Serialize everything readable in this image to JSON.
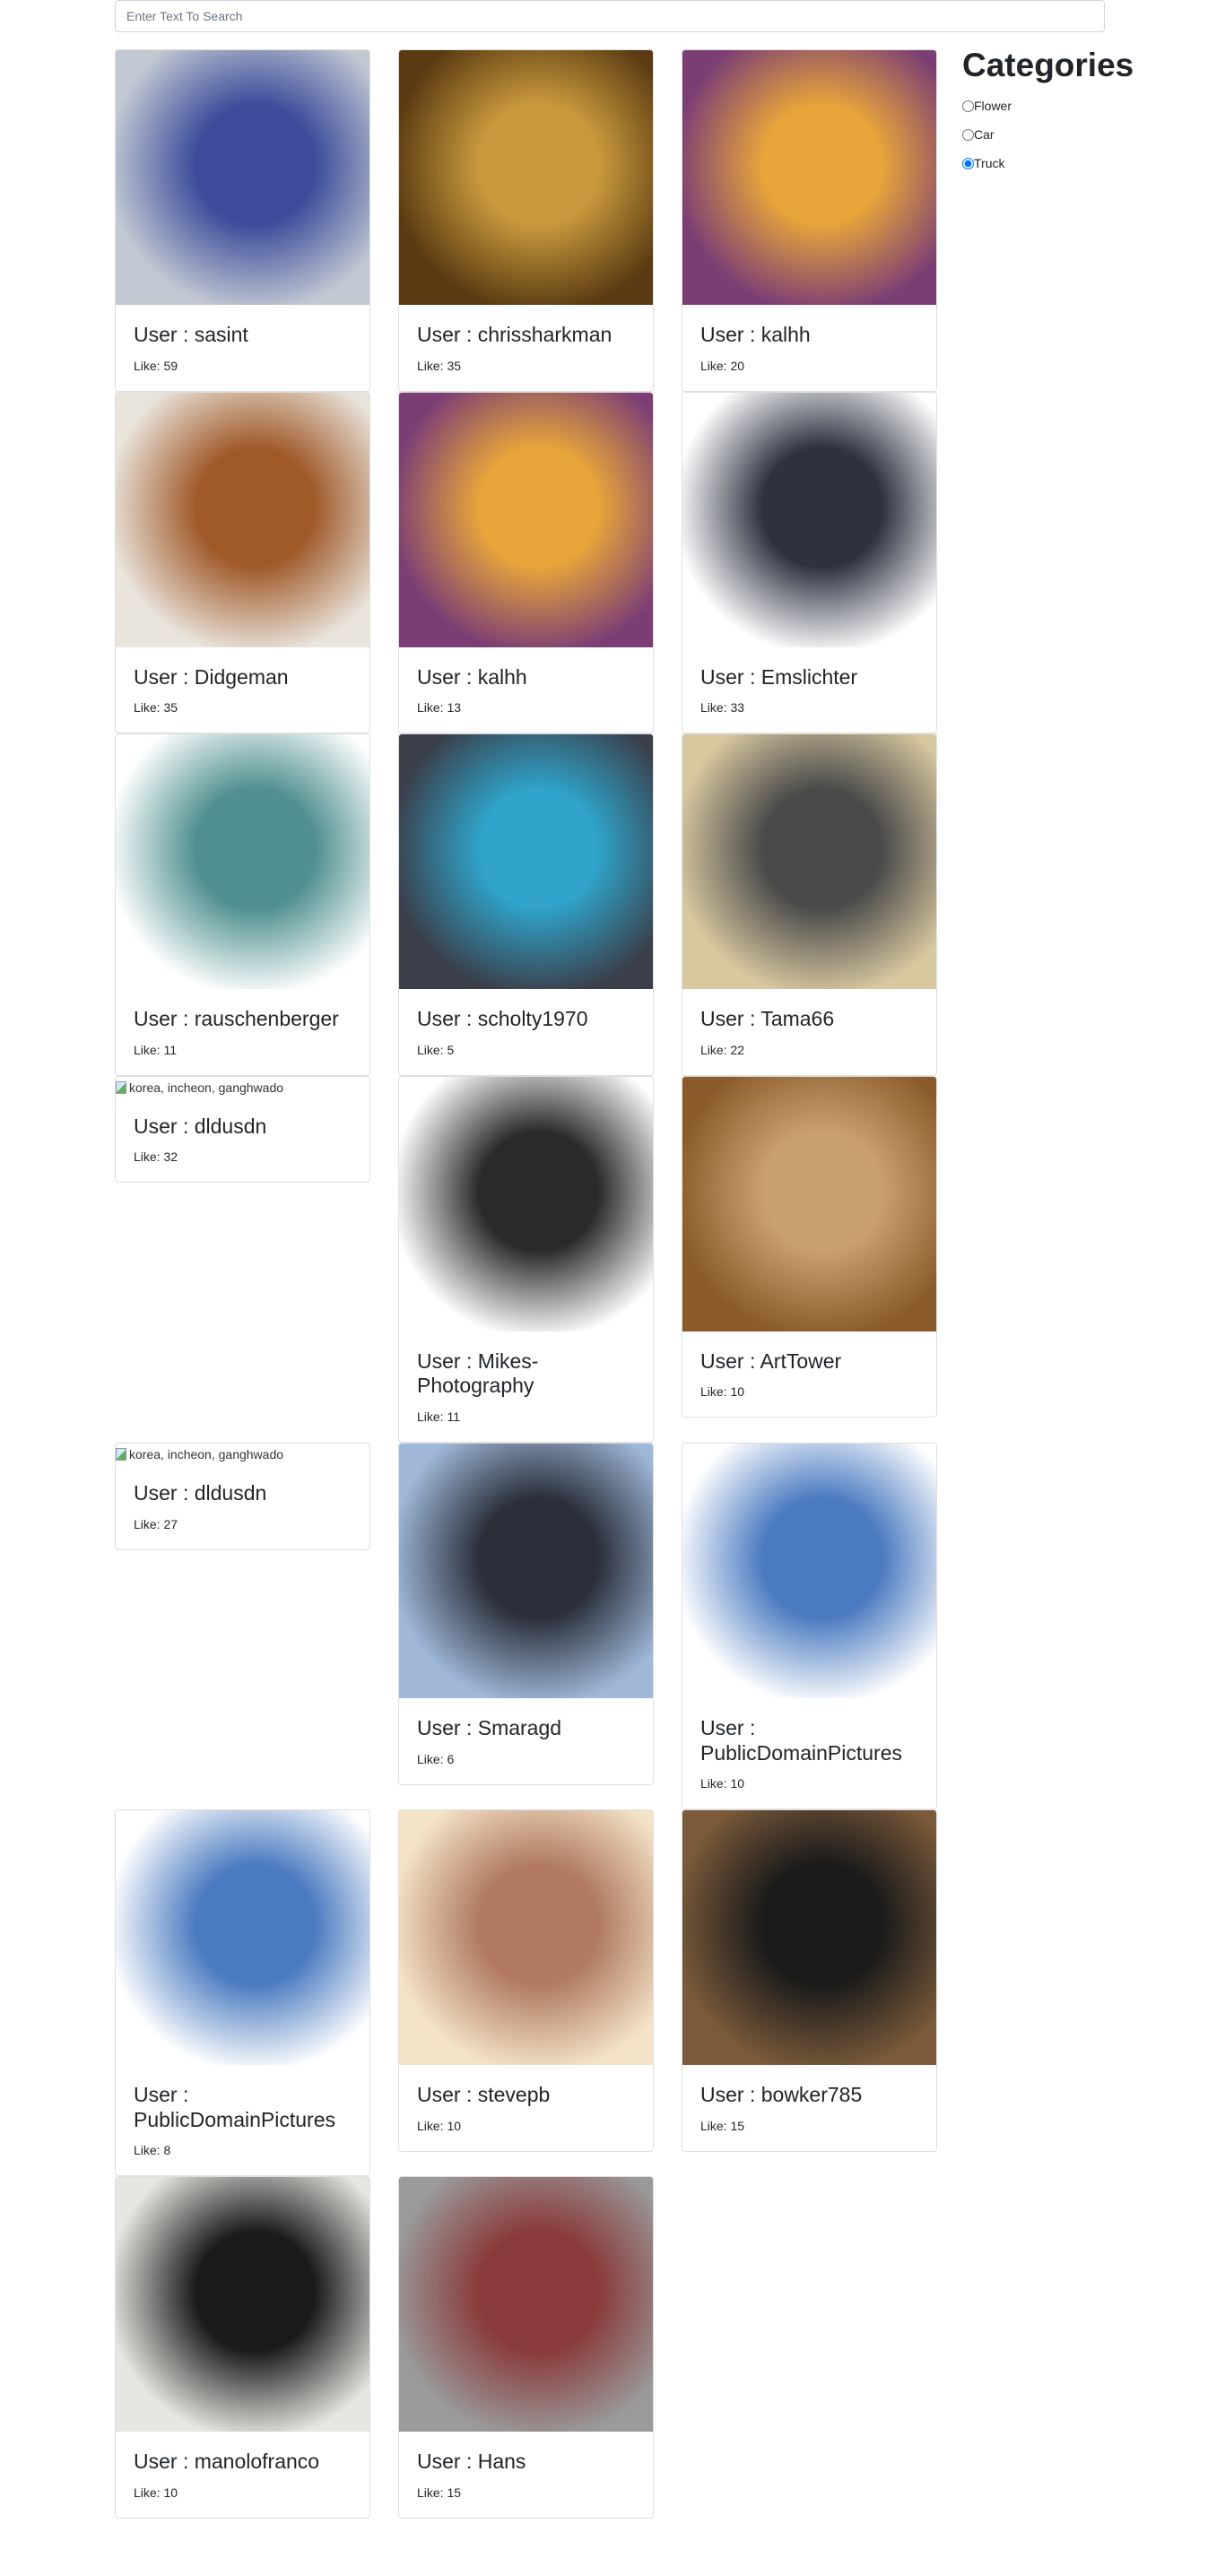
{
  "search": {
    "placeholder": "Enter Text To Search",
    "value": ""
  },
  "sidebar": {
    "title": "Categories",
    "options": [
      {
        "label": "Flower",
        "checked": false
      },
      {
        "label": "Car",
        "checked": false
      },
      {
        "label": "Truck",
        "checked": true
      }
    ]
  },
  "cards": [
    {
      "title": "User : sasint",
      "like": "Like: 59",
      "colors": [
        "#c3c9d3",
        "#3b4c9a"
      ]
    },
    {
      "title": "User : chrissharkman",
      "like": "Like: 35",
      "colors": [
        "#5a3a12",
        "#c99a3d"
      ]
    },
    {
      "title": "User : kalhh",
      "like": "Like: 20",
      "colors": [
        "#7b3e74",
        "#e7a53a"
      ]
    },
    {
      "title": "User : Didgeman",
      "like": "Like: 35",
      "colors": [
        "#e9e4dc",
        "#a05a2a"
      ]
    },
    {
      "title": "User : kalhh",
      "like": "Like: 13",
      "colors": [
        "#7b3e74",
        "#e7a53a"
      ]
    },
    {
      "title": "User : Emslichter",
      "like": "Like: 33",
      "colors": [
        "#ffffff",
        "#2d3140"
      ]
    },
    {
      "title": "User : rauschenberger",
      "like": "Like: 11",
      "colors": [
        "#ffffff",
        "#4f8f8f"
      ]
    },
    {
      "title": "User : scholty1970",
      "like": "Like: 5",
      "colors": [
        "#3a3f4a",
        "#2fa3c9"
      ]
    },
    {
      "title": "User : Tama66",
      "like": "Like: 22",
      "colors": [
        "#d8c8a0",
        "#4a4a4a"
      ]
    },
    {
      "title": "User : dldusdn",
      "like": "Like: 32",
      "broken_alt": "korea, incheon, ganghwado"
    },
    {
      "title": "User : Mikes-Photography",
      "like": "Like: 11",
      "colors": [
        "#ffffff",
        "#2a2a2a"
      ]
    },
    {
      "title": "User : ArtTower",
      "like": "Like: 10",
      "colors": [
        "#8a5a2a",
        "#c9a070"
      ]
    },
    {
      "title": "User : dldusdn",
      "like": "Like: 27",
      "broken_alt": "korea, incheon, ganghwado"
    },
    {
      "title": "User : Smaragd",
      "like": "Like: 6",
      "colors": [
        "#9fb8d8",
        "#2a2f3a"
      ]
    },
    {
      "title": "User : PublicDomainPictures",
      "like": "Like: 10",
      "colors": [
        "#ffffff",
        "#4a7ac0"
      ]
    },
    {
      "title": "User : PublicDomainPictures",
      "like": "Like: 8",
      "colors": [
        "#ffffff",
        "#4a7ac0"
      ]
    },
    {
      "title": "User : stevepb",
      "like": "Like: 10",
      "colors": [
        "#f3e3c8",
        "#b07a60"
      ]
    },
    {
      "title": "User : bowker785",
      "like": "Like: 15",
      "colors": [
        "#7a5a3a",
        "#1a1a1a"
      ]
    },
    {
      "title": "User : manolofranco",
      "like": "Like: 10",
      "colors": [
        "#e8e6e2",
        "#1a1a1a"
      ]
    },
    {
      "title": "User : Hans",
      "like": "Like: 15",
      "colors": [
        "#9a9a9a",
        "#8a3a3a"
      ]
    }
  ]
}
